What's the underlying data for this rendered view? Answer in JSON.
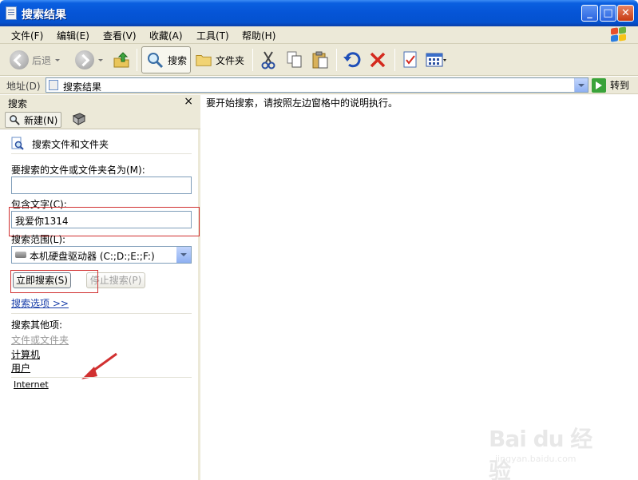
{
  "window": {
    "title": "搜索结果"
  },
  "menu": [
    "文件(F)",
    "编辑(E)",
    "查看(V)",
    "收藏(A)",
    "工具(T)",
    "帮助(H)"
  ],
  "toolbar": {
    "back": "后退",
    "search": "搜索",
    "folders": "文件夹"
  },
  "address": {
    "label": "地址(D)",
    "value": "搜索结果",
    "go": "转到"
  },
  "search_pane": {
    "title": "搜索",
    "close": "×",
    "new_label": "新建(N)",
    "heading": "搜索文件和文件夹",
    "name_label": "要搜索的文件或文件夹名为(M):",
    "name_value": "",
    "text_label": "包含文字(C):",
    "text_value": "我爱你1314",
    "scope_label": "搜索范围(L):",
    "scope_value": "本机硬盘驱动器 (C:;D:;E:;F:)",
    "search_now": "立即搜索(S)",
    "stop": "停止搜索(P)",
    "options": "搜索选项 >>",
    "other_heading": "搜索其他项:",
    "other_files": "文件或文件夹",
    "other_computers": "计算机",
    "other_people": "用户",
    "internet": "Internet"
  },
  "results": {
    "message": "要开始搜索，请按照左边窗格中的说明执行。"
  },
  "watermark": {
    "brand": "Bai du 经验",
    "url": "jingyan.baidu.com"
  },
  "colors": {
    "titlebar": "#0554d6",
    "chrome": "#ece9d8",
    "highlight": "#d13030"
  }
}
